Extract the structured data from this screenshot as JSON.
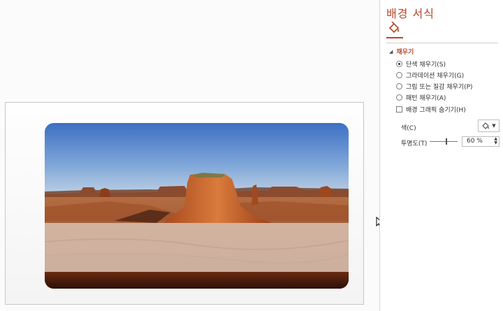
{
  "pane": {
    "title": "배경 서식",
    "fill_section": "채우기",
    "options": [
      {
        "label": "단색 채우기(S)",
        "selected": true
      },
      {
        "label": "그라데이션 채우기(G)",
        "selected": false
      },
      {
        "label": "그림 또는 질감 채우기(P)",
        "selected": false
      },
      {
        "label": "패턴 채우기(A)",
        "selected": false
      }
    ],
    "hide_graphics_label": "배경 그래픽 숨기기(H)",
    "hide_graphics_checked": false,
    "color_label": "색(C)",
    "transparency_label": "투명도(T)",
    "transparency_value": "60 %",
    "transparency_level": 0.6
  },
  "colors": {
    "accent": "#b7472a",
    "pane_bg": "#ffffff",
    "canvas_bg": "#fbfbfb"
  },
  "icons": [
    "paint-bucket-icon",
    "collapse-caret-icon",
    "dropdown-arrow-icon",
    "spin-up-icon",
    "spin-down-icon",
    "mouse-cursor-icon"
  ]
}
